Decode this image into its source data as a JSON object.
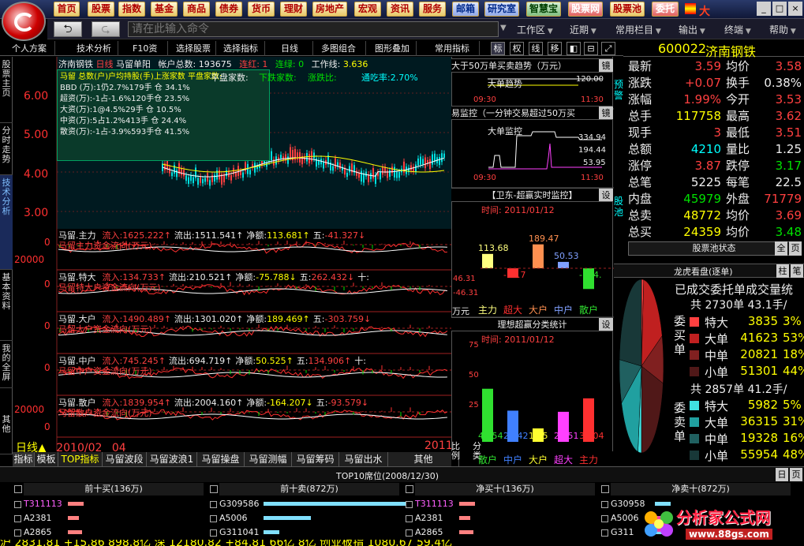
{
  "topmenu": {
    "items": [
      "首页",
      "股票",
      "指数",
      "基金",
      "商品",
      "债券",
      "货币",
      "理财",
      "房地产",
      "宏观",
      "资讯",
      "服务",
      "邮箱",
      "研究室",
      "智慧宝",
      "股票网",
      "股票池",
      "委托"
    ],
    "logo_text": "大"
  },
  "toolbar": {
    "command_placeholder": "请在此输入命令",
    "menus": [
      "工作区",
      "近期",
      "常用栏目",
      "输出",
      "终端",
      "帮助"
    ]
  },
  "tabbar": {
    "items": [
      "个人方案",
      "技术分析",
      "F10资料",
      "选择股票",
      "选择指标",
      "日线",
      "多图组合",
      "图形叠加",
      "常用指标"
    ],
    "small": [
      "标",
      "权",
      "线",
      "移"
    ]
  },
  "left_tabs": [
    "股票主页",
    "分时走势",
    "技术分析",
    "基本资料",
    "我的全屏",
    "其他"
  ],
  "main_chart": {
    "header": {
      "name": "济南钢铁",
      "period": "日线",
      "indicator": "马留单阳",
      "stat_label": "帐户总数:",
      "stat_value": "193675",
      "lian_hong": "连红: 1",
      "lian_lv": "连绿: 0",
      "work_label": "工作线:",
      "work_value": "3.636"
    },
    "yaxis": [
      "6.00",
      "5.00",
      "4.00",
      "3.00"
    ],
    "labels": [
      "马留",
      "马留",
      "马留",
      "马留"
    ],
    "info_lines": [
      "马留 总数(户)户均持股(手)上涨家数 平盘家数:",
      "BBD (万):1仍2.7%179手 仓 34.1%",
      "超资(万):-1占-1.6%120手仓 23.5%",
      "大资(万):1@4.5%29手 仓 10.5%",
      "中资(万):5占1.2%413手 仓 24.4%",
      "散资(万):-1占-3.9%593手仓 41.5%",
      "马留",
      "平盘家数:",
      "下跌家数:",
      "涨跌比:",
      "通吃率:2.70%"
    ]
  },
  "panels": [
    {
      "name": "马留.主力",
      "in_label": "流入:",
      "in": "1625.222↑",
      "out_label": "流出:",
      "out": "1511.541↑",
      "net_label": "净额:",
      "net": "113.681↑",
      "five_label": "五:",
      "five": "-41.327↓",
      "y_top": "0",
      "y_mid": "20000",
      "sub": "马留主力资金流向(万元)"
    },
    {
      "name": "马留.特大",
      "in_label": "流入:",
      "in": "134.733↑",
      "out_label": "流出:",
      "out": "210.521↑",
      "net_label": "净额:",
      "net": "-75.788↓",
      "five_label": "五:",
      "five": "262.432↓",
      "extra": "十:",
      "y_top": "0",
      "y_mid": "",
      "sub": "马留特大户资金流向(万元)"
    },
    {
      "name": "马留.大户",
      "in_label": "流入:",
      "in": "1490.489↑",
      "out_label": "流出:",
      "out": "1301.020↑",
      "net_label": "净额:",
      "net": "189.469↑",
      "five_label": "五:",
      "five": "-303.759↓",
      "y_top": "0",
      "y_mid": "",
      "sub": "马留大户资金流向(万元)"
    },
    {
      "name": "马留.中户",
      "in_label": "流入:",
      "in": "745.245↑",
      "out_label": "流出:",
      "out": "694.719↑",
      "net_label": "净额:",
      "net": "50.525↑",
      "five_label": "五:",
      "five": "134.906↑",
      "extra": "十:",
      "y_top": "0",
      "y_mid": "",
      "sub": "马留中户资金流向(万元)"
    },
    {
      "name": "马留.散户",
      "in_label": "流入:",
      "in": "1839.954↑",
      "out_label": "流出:",
      "out": "2004.160↑",
      "net_label": "净额:",
      "net": "-164.207↓",
      "five_label": "五:",
      "five": "-93.579↓",
      "y_top": "20000",
      "y_mid": "0",
      "sub": "马留散户资金流向(万元)"
    }
  ],
  "xaxis": {
    "period": "日线",
    "start": "2010/02",
    "mid": "04",
    "end": "2011"
  },
  "bottom_tabs": [
    "指标",
    "模板",
    "TOP指标",
    "马留波段",
    "马留波浪1",
    "马留操盘",
    "马留测幅",
    "马留筹码",
    "马留出水",
    "其他"
  ],
  "right_vertical": [
    "比例",
    "分类",
    "预警",
    "股池"
  ],
  "mid": {
    "trend_title": "大于50万单买卖趋势（万元）",
    "trend_btn": "镜",
    "trend_inner": "大单趋势",
    "trend_val": "120.00",
    "t1": "09:30",
    "t2": "11:30",
    "monitor_title": "易监控（一分钟交易超过50万买",
    "monitor_btn": "镜",
    "monitor_inner": "大单监控",
    "m_vals": [
      "334.94",
      "194.44",
      "53.95"
    ],
    "super_title": "【卫东-超赢实时监控】",
    "super_btn": "设",
    "super_time": "时间: 2011/01/12",
    "super_unit": "万元",
    "super_y": [
      "46.31",
      "-46.31"
    ],
    "ideal_title": "理想超赢分类统计",
    "ideal_btn": "设",
    "ideal_time": "时间: 2011/01/12",
    "ideal_y": [
      "75",
      "50",
      "25"
    ]
  },
  "chart_data": [
    {
      "type": "bar",
      "title": "【卫东-超赢实时监控】",
      "categories": [
        "主力",
        "超大",
        "大户",
        "中户",
        "散户"
      ],
      "values": [
        113.68,
        -75.79,
        189.47,
        50.53,
        -164.2
      ],
      "value_labels": [
        "113.68",
        "-75.7",
        "189.47",
        "50.53",
        "-164."
      ],
      "colors": [
        "#ffff80",
        "#ff3030",
        "#ff9050",
        "#80a0ff",
        "#30e030"
      ]
    },
    {
      "type": "bar",
      "title": "理想超赢分类统计",
      "categories": [
        "散户",
        "中户",
        "大户",
        "超大",
        "主力"
      ],
      "values": [
        41.54,
        24.42,
        10.53,
        23.51,
        34.04
      ],
      "value_labels": [
        "41.54",
        "24.42",
        "10.5",
        "23.51",
        "34.04"
      ],
      "colors": [
        "#30e030",
        "#4080ff",
        "#ffff30",
        "#ff40ff",
        "#ff3030"
      ]
    }
  ],
  "quote": {
    "code": "600022",
    "name": "济南钢铁",
    "rows": [
      {
        "l": "最新",
        "v": "3.59",
        "c": "#ff4040",
        "l2": "均价",
        "v2": "3.58",
        "c2": "#ff4040"
      },
      {
        "l": "涨跌",
        "v": "+0.07",
        "c": "#ff4040",
        "l2": "换手",
        "v2": "0.38%",
        "c2": "#eee"
      },
      {
        "l": "涨幅",
        "v": "1.99%",
        "c": "#ff4040",
        "l2": "今开",
        "v2": "3.53",
        "c2": "#ff4040"
      },
      {
        "l": "总手",
        "v": "117758",
        "c": "#ffff00",
        "l2": "最高",
        "v2": "3.62",
        "c2": "#ff4040"
      },
      {
        "l": "现手",
        "v": "3",
        "c": "#ff4040",
        "l2": "最低",
        "v2": "3.51",
        "c2": "#ff4040"
      },
      {
        "l": "总额",
        "v": "4210",
        "c": "#00ffff",
        "l2": "量比",
        "v2": "1.25",
        "c2": "#eee"
      },
      {
        "l": "涨停",
        "v": "3.87",
        "c": "#ff4040",
        "l2": "跌停",
        "v2": "3.17",
        "c2": "#00e000"
      },
      {
        "l": "总笔",
        "v": "5225",
        "c": "#eee",
        "l2": "每笔",
        "v2": "22.5",
        "c2": "#eee"
      },
      {
        "l": "内盘",
        "v": "45979",
        "c": "#00e000",
        "l2": "外盘",
        "v2": "71779",
        "c2": "#ff4040"
      },
      {
        "l": "总卖",
        "v": "48772",
        "c": "#ffff00",
        "l2": "均价",
        "v2": "3.69",
        "c2": "#ff4040"
      },
      {
        "l": "总买",
        "v": "24359",
        "c": "#ffff00",
        "l2": "均价",
        "v2": "3.48",
        "c2": "#00e000"
      }
    ],
    "pool_status": "股票池状态",
    "pool_btn": "全",
    "pool_btn2": "页"
  },
  "dragon": {
    "title": "龙虎看盘(逐单)",
    "btn": "柱",
    "btn2": "笔",
    "subtitle": "已成交委托单成交量统",
    "buy_label": "委买单",
    "sell_label": "委卖单",
    "buy_total": "共 2730单 43.1手/",
    "buy_rows": [
      {
        "n": "特大",
        "v": "3835",
        "p": "3%",
        "c": "#ff4040"
      },
      {
        "n": "大单",
        "v": "41623",
        "p": "53%",
        "c": "#c02020"
      },
      {
        "n": "中单",
        "v": "20821",
        "p": "18%",
        "c": "#802020"
      },
      {
        "n": "小单",
        "v": "51301",
        "p": "44%",
        "c": "#501818"
      }
    ],
    "sell_total": "共 2857单 41.2手/",
    "sell_rows": [
      {
        "n": "特大",
        "v": "5982",
        "p": "5%",
        "c": "#40e0e0"
      },
      {
        "n": "大单",
        "v": "36315",
        "p": "31%",
        "c": "#20a0a0"
      },
      {
        "n": "中单",
        "v": "19328",
        "p": "16%",
        "c": "#206060"
      },
      {
        "n": "小单",
        "v": "55954",
        "p": "48%",
        "c": "#183838"
      }
    ]
  },
  "top10": {
    "title": "TOP10席位(2008/12/30)",
    "btn": "日",
    "btn2": "页",
    "cols": [
      {
        "h": "前十买(136万)",
        "rows": [
          {
            "n": "T311113",
            "c": "#ff60ff"
          },
          {
            "n": "A2381",
            "c": "#eee"
          },
          {
            "n": "A2865",
            "c": "#eee"
          }
        ]
      },
      {
        "h": "前十卖(872万)",
        "rows": [
          {
            "n": "G309586",
            "c": "#eee"
          },
          {
            "n": "A5006",
            "c": "#eee"
          },
          {
            "n": "G311041",
            "c": "#eee"
          }
        ]
      },
      {
        "h": "净买十(136万)",
        "rows": [
          {
            "n": "T311113",
            "c": "#ff60ff"
          },
          {
            "n": "A2381",
            "c": "#eee"
          },
          {
            "n": "A2865",
            "c": "#eee"
          }
        ]
      },
      {
        "h": "净卖十(872万)",
        "rows": [
          {
            "n": "G30958",
            "c": "#eee"
          },
          {
            "n": "A5006",
            "c": "#eee"
          },
          {
            "n": "G311",
            "c": "#eee"
          }
        ]
      }
    ]
  },
  "ticker": "沪 2831.81 +15.86 898.8亿 深 12180.82 +84.81 66亿 8亿 创业板指 1080.67 59.4亿",
  "watermark": {
    "title": "分析家公式网",
    "url": "www.88gs.com"
  }
}
